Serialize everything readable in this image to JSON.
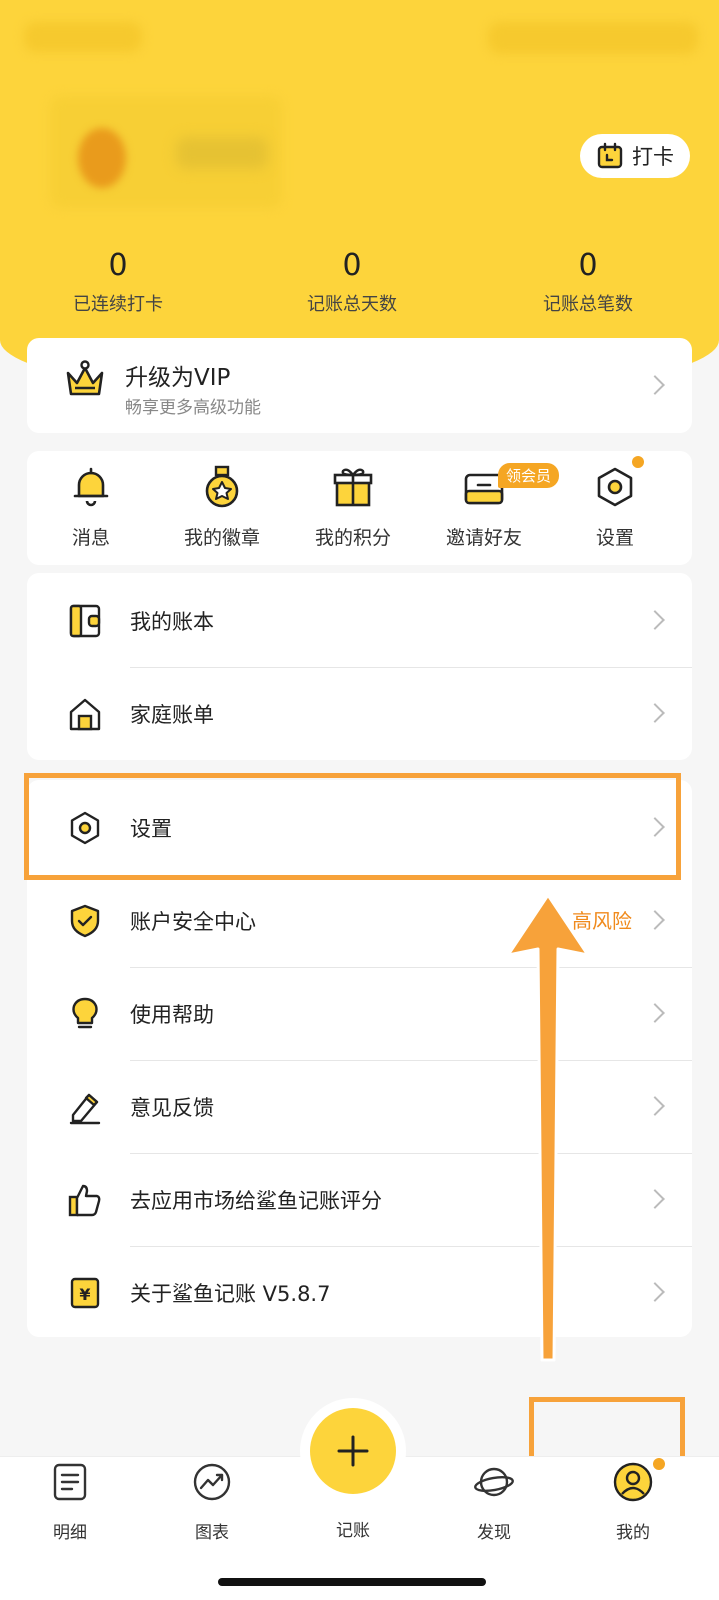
{
  "header": {
    "checkin_label": "打卡",
    "stats": [
      {
        "value": "0",
        "label": "已连续打卡"
      },
      {
        "value": "0",
        "label": "记账总天数"
      },
      {
        "value": "0",
        "label": "记账总笔数"
      }
    ]
  },
  "vip": {
    "title": "升级为VIP",
    "subtitle": "畅享更多高级功能"
  },
  "quick_actions": [
    {
      "label": "消息",
      "icon": "bell-icon"
    },
    {
      "label": "我的徽章",
      "icon": "medal-icon"
    },
    {
      "label": "我的积分",
      "icon": "gift-icon"
    },
    {
      "label": "邀请好友",
      "icon": "invite-icon"
    },
    {
      "label": "设置",
      "icon": "settings-hex-icon"
    }
  ],
  "invite_badge": "领会员",
  "menu_group1": [
    {
      "label": "我的账本",
      "icon": "ledger-icon"
    },
    {
      "label": "家庭账单",
      "icon": "house-icon"
    }
  ],
  "menu_group2": [
    {
      "label": "设置",
      "icon": "settings-hex-icon"
    },
    {
      "label": "账户安全中心",
      "icon": "shield-icon",
      "status": "高风险"
    },
    {
      "label": "使用帮助",
      "icon": "lightbulb-icon"
    },
    {
      "label": "意见反馈",
      "icon": "pencil-icon"
    },
    {
      "label": "去应用市场给鲨鱼记账评分",
      "icon": "thumbs-up-icon"
    },
    {
      "label": "关于鲨鱼记账 V5.8.7",
      "icon": "yen-icon"
    }
  ],
  "tabbar": {
    "tabs": [
      {
        "label": "明细",
        "icon": "list-icon"
      },
      {
        "label": "图表",
        "icon": "chart-icon"
      },
      {
        "label": "记账",
        "icon": "plus-icon"
      },
      {
        "label": "发现",
        "icon": "planet-icon"
      },
      {
        "label": "我的",
        "icon": "user-icon"
      }
    ]
  },
  "colors": {
    "accent": "#fdd43b",
    "highlight": "#f7a23a",
    "warning": "#f08a1c"
  }
}
